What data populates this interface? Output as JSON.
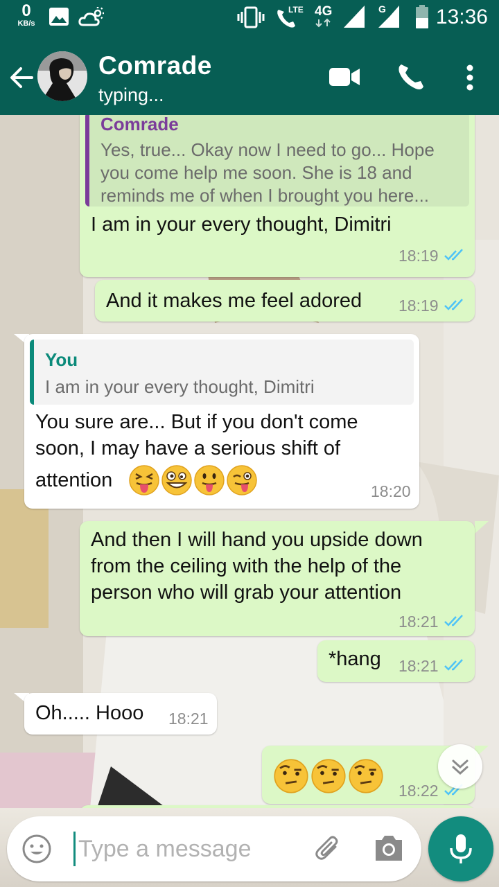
{
  "status_bar": {
    "net_speed_value": "0",
    "net_speed_unit": "KB/s",
    "lte_label": "LTE",
    "network_label": "4G",
    "sim2_label": "G",
    "time": "13:36"
  },
  "header": {
    "contact_name": "Comrade",
    "status": "typing..."
  },
  "messages": [
    {
      "direction": "outgoing",
      "quote_author": "Comrade",
      "quote_lines": [
        "Yes, true... Okay now I need to go... Hope",
        "you come help me soon. She is 18 and",
        "reminds me of when I brought you here..."
      ],
      "text": "I am in your every thought, Dimitri",
      "time": "18:19",
      "receipt": "read"
    },
    {
      "direction": "outgoing",
      "text": "And it makes me feel adored",
      "time": "18:19",
      "receipt": "read"
    },
    {
      "direction": "incoming",
      "quote_author": "You",
      "quote_lines": [
        "I am in your every thought, Dimitri"
      ],
      "lines": [
        "You sure are... But if you don't come",
        "soon, I may have a serious shift of",
        "attention"
      ],
      "emoji": [
        "squinting-tongue-face",
        "zany-face",
        "tongue-face",
        "winking-tongue-face"
      ],
      "time": "18:20"
    },
    {
      "direction": "outgoing",
      "lines": [
        "And then I will hand you upside down",
        "from the ceiling with the help of the",
        "person who will grab your attention"
      ],
      "time": "18:21",
      "receipt": "read"
    },
    {
      "direction": "outgoing",
      "text": "*hang",
      "time": "18:21",
      "receipt": "read"
    },
    {
      "direction": "incoming",
      "text": "Oh..... Hooo",
      "time": "18:21"
    },
    {
      "direction": "outgoing",
      "emoji": [
        "raised-eyebrow-face",
        "raised-eyebrow-face",
        "raised-eyebrow-face"
      ],
      "time": "18:22",
      "receipt": "read"
    }
  ],
  "composer": {
    "placeholder": "Type a message"
  },
  "colors": {
    "header": "#075e54",
    "outgoing_bubble": "#dcf8c6",
    "incoming_bubble": "#ffffff",
    "read_ticks": "#4fc3f7",
    "accent": "#128c7e",
    "quote_author_purple": "#7b3c9a",
    "quote_author_teal": "#0b8a7a"
  },
  "icons": [
    "back-arrow-icon",
    "video-call-icon",
    "voice-call-icon",
    "more-options-icon",
    "emoji-icon",
    "attach-icon",
    "camera-icon",
    "mic-icon",
    "scroll-down-icon"
  ]
}
